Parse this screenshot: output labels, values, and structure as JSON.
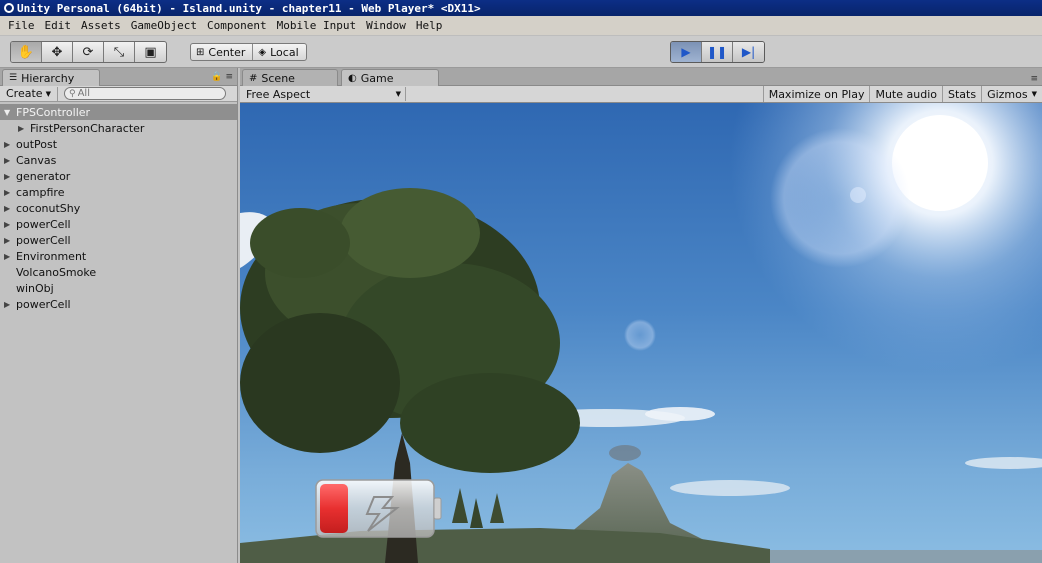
{
  "window": {
    "title": "Unity Personal (64bit) - Island.unity - chapter11 - Web Player* <DX11>"
  },
  "menu": [
    "File",
    "Edit",
    "Assets",
    "GameObject",
    "Component",
    "Mobile Input",
    "Window",
    "Help"
  ],
  "toolbar": {
    "transform_tools": [
      {
        "name": "hand-tool",
        "icon": "hand-icon",
        "glyph": "✋",
        "active": true
      },
      {
        "name": "move-tool",
        "icon": "move-icon",
        "glyph": "✥",
        "active": false
      },
      {
        "name": "rotate-tool",
        "icon": "rotate-icon",
        "glyph": "⟳",
        "active": false
      },
      {
        "name": "scale-tool",
        "icon": "scale-icon",
        "glyph": "⤡",
        "active": false
      },
      {
        "name": "rect-tool",
        "icon": "rect-icon",
        "glyph": "▣",
        "active": false
      }
    ],
    "pivot_label": "Center",
    "space_label": "Local",
    "playback": [
      {
        "name": "play-button",
        "icon": "play-icon",
        "glyph": "▶",
        "on": true
      },
      {
        "name": "pause-button",
        "icon": "pause-icon",
        "glyph": "❚❚",
        "on": false
      },
      {
        "name": "step-button",
        "icon": "step-icon",
        "glyph": "▶|",
        "on": false
      }
    ]
  },
  "hierarchy": {
    "tab_label": "Hierarchy",
    "create_label": "Create",
    "search_placeholder": "All",
    "items": [
      {
        "label": "FPSController",
        "expanded": true,
        "has_children": true,
        "selected": true,
        "depth": 0
      },
      {
        "label": "FirstPersonCharacter",
        "expanded": false,
        "has_children": true,
        "selected": false,
        "depth": 1
      },
      {
        "label": "outPost",
        "expanded": false,
        "has_children": true,
        "selected": false,
        "depth": 0
      },
      {
        "label": "Canvas",
        "expanded": false,
        "has_children": true,
        "selected": false,
        "depth": 0
      },
      {
        "label": "generator",
        "expanded": false,
        "has_children": true,
        "selected": false,
        "depth": 0
      },
      {
        "label": "campfire",
        "expanded": false,
        "has_children": true,
        "selected": false,
        "depth": 0
      },
      {
        "label": "coconutShy",
        "expanded": false,
        "has_children": true,
        "selected": false,
        "depth": 0
      },
      {
        "label": "powerCell",
        "expanded": false,
        "has_children": true,
        "selected": false,
        "depth": 0
      },
      {
        "label": "powerCell",
        "expanded": false,
        "has_children": true,
        "selected": false,
        "depth": 0
      },
      {
        "label": "Environment",
        "expanded": false,
        "has_children": true,
        "selected": false,
        "depth": 0
      },
      {
        "label": "VolcanoSmoke",
        "expanded": false,
        "has_children": false,
        "selected": false,
        "depth": 0
      },
      {
        "label": "winObj",
        "expanded": false,
        "has_children": false,
        "selected": false,
        "depth": 0
      },
      {
        "label": "powerCell",
        "expanded": false,
        "has_children": true,
        "selected": false,
        "depth": 0
      }
    ]
  },
  "game": {
    "scene_tab_label": "Scene",
    "game_tab_label": "Game",
    "aspect_label": "Free Aspect",
    "maximize_label": "Maximize on Play",
    "mute_label": "Mute audio",
    "stats_label": "Stats",
    "gizmos_label": "Gizmos",
    "battery_charge": 0.2
  },
  "colors": {
    "title_bar": "#08246b",
    "selection": "#8f8f8f",
    "play_active": "#7c92b5",
    "battery_red": "#e83030"
  }
}
